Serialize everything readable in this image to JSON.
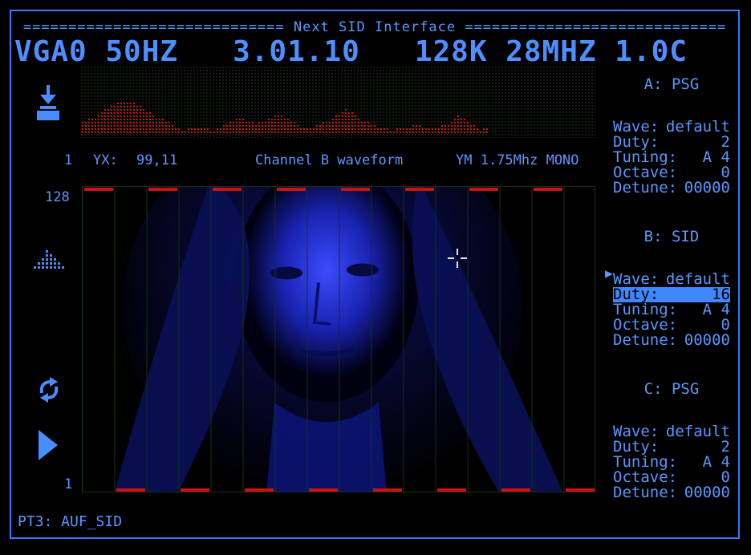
{
  "header": {
    "title": "============================= Next SID Interface =============================",
    "status": "VGA0 50HZ   3.01.10   128K 28MHZ 1.0C"
  },
  "info": {
    "index": "1",
    "yx_label": "YX:",
    "yx_value": "99,11",
    "channel": "Channel B waveform",
    "chip": "YM 1.75Mhz MONO"
  },
  "scale": {
    "top": "128",
    "bottom": "1"
  },
  "bottom_label": "PT3: AUF_SID",
  "colors": {
    "accent": "#4a8cff",
    "bar_red": "#cc1111",
    "grid_green": "#153015"
  },
  "icons": [
    "download-icon",
    "equalizer-icon",
    "loop-icon",
    "play-icon",
    "crosshair-icon"
  ],
  "channels": [
    {
      "header": "A: PSG",
      "rows": [
        {
          "label": "Wave:",
          "value": "default"
        },
        {
          "label": "Duty:",
          "value": "2"
        },
        {
          "label": "Tuning:",
          "value": "A 4"
        },
        {
          "label": "Octave:",
          "value": "0"
        },
        {
          "label": "Detune:",
          "value": "00000"
        }
      ]
    },
    {
      "header": "B: SID",
      "rows": [
        {
          "label": "Wave:",
          "value": "default"
        },
        {
          "label": "Duty:",
          "value": "16"
        },
        {
          "label": "Tuning:",
          "value": "A 4"
        },
        {
          "label": "Octave:",
          "value": "0"
        },
        {
          "label": "Detune:",
          "value": "00000"
        }
      ]
    },
    {
      "header": "C: PSG",
      "rows": [
        {
          "label": "Wave:",
          "value": "default"
        },
        {
          "label": "Duty:",
          "value": "2"
        },
        {
          "label": "Tuning:",
          "value": "A 4"
        },
        {
          "label": "Octave:",
          "value": "0"
        },
        {
          "label": "Detune:",
          "value": "00000"
        }
      ]
    }
  ],
  "selected_channel": 1,
  "selected_row": 1
}
